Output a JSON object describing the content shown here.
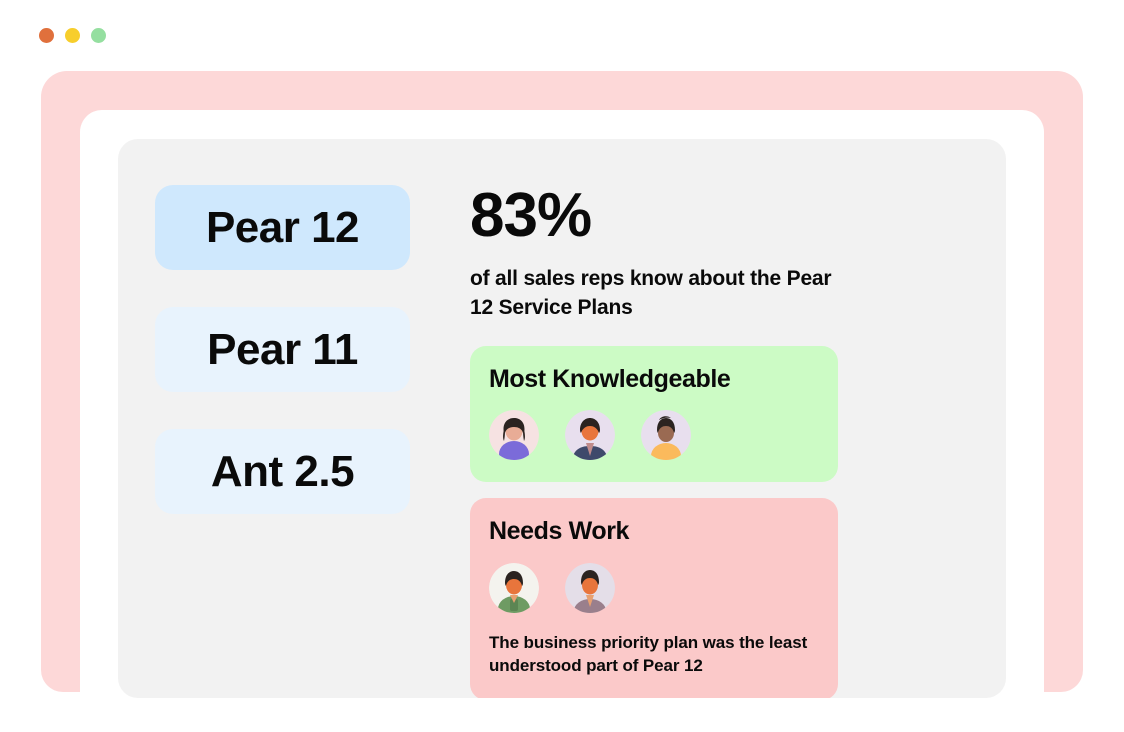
{
  "window": {
    "traffic_lights": [
      {
        "name": "close",
        "color": "#E0703C"
      },
      {
        "name": "minimize",
        "color": "#F7CE2C"
      },
      {
        "name": "maximize",
        "color": "#95DFA0"
      }
    ],
    "frame_color": "#FDD8D8",
    "panel_color": "#F2F2F2"
  },
  "versions": {
    "items": [
      {
        "label": "Pear 12",
        "selected": true,
        "bg": "#CFE8FD"
      },
      {
        "label": "Pear 11",
        "selected": false,
        "bg": "#E8F3FD"
      },
      {
        "label": "Ant 2.5",
        "selected": false,
        "bg": "#E8F3FD"
      }
    ]
  },
  "detail": {
    "stat_value": "83%",
    "stat_caption": "of all sales reps know about the Pear 12 Service Plans",
    "good_card": {
      "title": "Most Knowledgeable",
      "bg": "#CCFBC5",
      "avatars": [
        {
          "name": "avatar-rep-1",
          "bg": "#F6E2E2",
          "hair": "#2B2320",
          "skin": "#E8AC96",
          "shirt": "#7B6BD9"
        },
        {
          "name": "avatar-rep-2",
          "bg": "#E8DFEE",
          "hair": "#2B2320",
          "skin": "#E8753C",
          "shirt": "#3F4A6B"
        },
        {
          "name": "avatar-rep-3",
          "bg": "#E8DFEE",
          "hair": "#2B2320",
          "skin": "#9A6A52",
          "shirt": "#FBBA5C"
        }
      ]
    },
    "bad_card": {
      "title": "Needs Work",
      "bg": "#FBC9C9",
      "avatars": [
        {
          "name": "avatar-rep-4",
          "bg": "#F4F3EE",
          "hair": "#2B2320",
          "skin": "#E8753C",
          "shirt": "#6E9B63"
        },
        {
          "name": "avatar-rep-5",
          "bg": "#E4DEE8",
          "hair": "#2B2320",
          "skin": "#E8753C",
          "shirt": "#9A7F8C"
        }
      ]
    },
    "note": "The business priority plan was the least understood part of Pear 12"
  }
}
